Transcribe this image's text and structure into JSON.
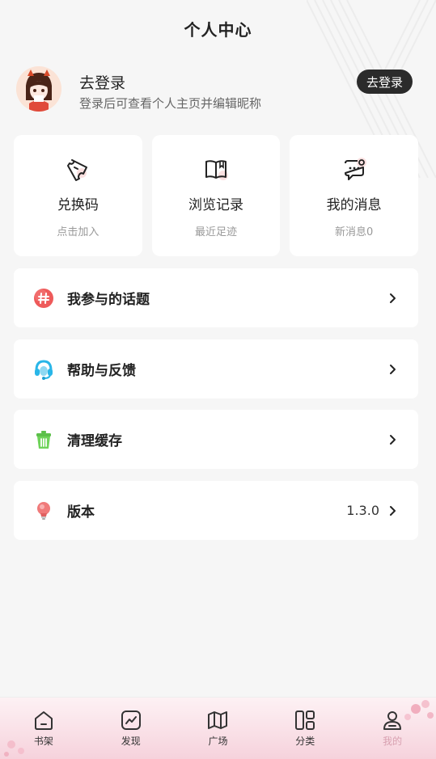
{
  "header": {
    "title": "个人中心"
  },
  "profile": {
    "name": "去登录",
    "subtitle": "登录后可查看个人主页并编辑昵称",
    "login_button": "去登录"
  },
  "cards": [
    {
      "icon": "ticket-icon",
      "title": "兑换码",
      "subtitle": "点击加入"
    },
    {
      "icon": "book-icon",
      "title": "浏览记录",
      "subtitle": "最近足迹"
    },
    {
      "icon": "message-icon",
      "title": "我的消息",
      "subtitle": "新消息0"
    }
  ],
  "menu": [
    {
      "icon": "hashtag-icon",
      "label": "我参与的话题",
      "value": ""
    },
    {
      "icon": "headset-icon",
      "label": "帮助与反馈",
      "value": ""
    },
    {
      "icon": "trash-icon",
      "label": "清理缓存",
      "value": ""
    },
    {
      "icon": "lightbulb-icon",
      "label": "版本",
      "value": "1.3.0"
    }
  ],
  "tabbar": [
    {
      "icon": "home-icon",
      "label": "书架"
    },
    {
      "icon": "trend-icon",
      "label": "发现"
    },
    {
      "icon": "map-icon",
      "label": "广场"
    },
    {
      "icon": "category-icon",
      "label": "分类"
    },
    {
      "icon": "user-icon",
      "label": "我的",
      "active": true
    }
  ],
  "colors": {
    "background": "#f6f6f6",
    "button_dark": "#2b2b2b",
    "active_tab": "#d8a0b0",
    "hashtag": "#ee5a5a",
    "headset": "#29b6e8",
    "trash": "#5cc04a",
    "lightbulb": "#f07a7a"
  }
}
